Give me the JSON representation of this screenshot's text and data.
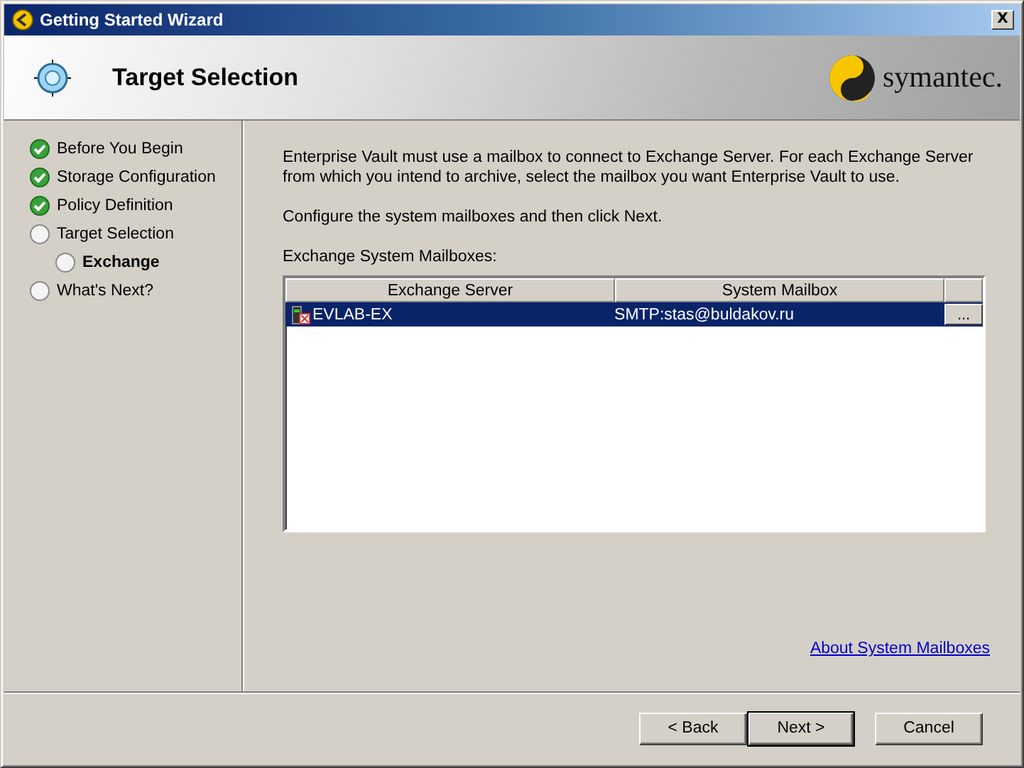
{
  "window": {
    "title": "Getting Started Wizard",
    "close": "X"
  },
  "header": {
    "title": "Target Selection",
    "brand": "symantec."
  },
  "steps": [
    {
      "label": "Before You Begin",
      "completed": true,
      "current": false
    },
    {
      "label": "Storage Configuration",
      "completed": true,
      "current": false
    },
    {
      "label": "Policy Definition",
      "completed": true,
      "current": false
    },
    {
      "label": "Target Selection",
      "completed": false,
      "current": false,
      "children": [
        {
          "label": "Exchange",
          "completed": false,
          "current": true
        }
      ]
    },
    {
      "label": "What's Next?",
      "completed": false,
      "current": false
    }
  ],
  "content": {
    "intro": "Enterprise Vault must use a mailbox to connect to Exchange Server. For each Exchange Server from which you intend to archive, select the mailbox you want Enterprise Vault to use.",
    "instruction": "Configure the system mailboxes and then click Next.",
    "table_label": "Exchange System Mailboxes:",
    "table": {
      "columns": [
        "Exchange Server",
        "System Mailbox"
      ],
      "rows": [
        {
          "server": "EVLAB-EX",
          "mailbox": "SMTP:stas@buldakov.ru",
          "browse": "...",
          "selected": true
        }
      ]
    },
    "link": "About System Mailboxes"
  },
  "buttons": [
    {
      "label": "< Back",
      "default": false
    },
    {
      "label": "Next >",
      "default": true
    },
    {
      "label": "Cancel",
      "default": false
    }
  ]
}
